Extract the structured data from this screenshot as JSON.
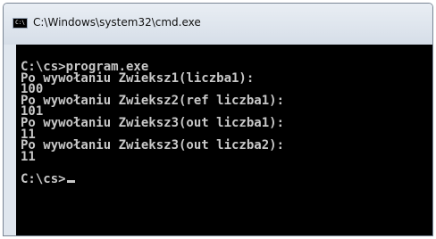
{
  "window": {
    "title": "C:\\Windows\\system32\\cmd.exe",
    "icon_text": "C:\\"
  },
  "console": {
    "lines": [
      "C:\\cs>program.exe",
      "Po wywołaniu Zwieksz1(liczba1):",
      "100",
      "Po wywołaniu Zwieksz2(ref liczba1):",
      "101",
      "Po wywołaniu Zwieksz3(out liczba1):",
      "11",
      "Po wywołaniu Zwieksz3(out liczba2):",
      "11"
    ],
    "prompt": "C:\\cs>"
  },
  "colors": {
    "console_background": "#000000",
    "console_text": "#c8c8c8"
  }
}
